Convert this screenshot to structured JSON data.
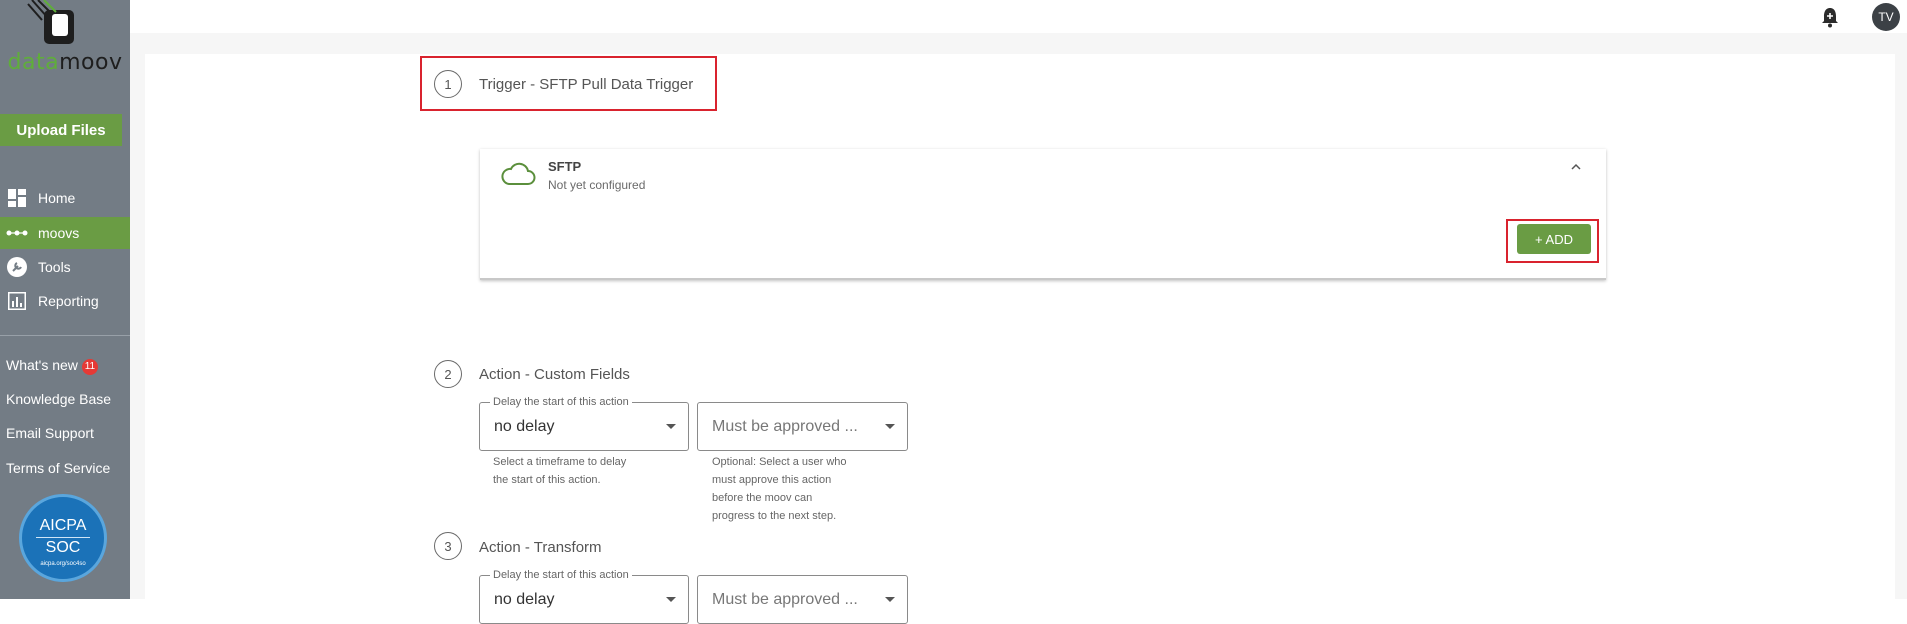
{
  "sidebar": {
    "logo": {
      "word_a": "data",
      "word_b": "moov"
    },
    "upload_label": "Upload Files",
    "nav": [
      {
        "label": "Home",
        "icon": "dashboard-icon"
      },
      {
        "label": "moovs",
        "icon": "dots-flow-icon"
      },
      {
        "label": "Tools",
        "icon": "wrench-icon"
      },
      {
        "label": "Reporting",
        "icon": "bar-chart-icon"
      }
    ],
    "links": {
      "whats_new": "What's new",
      "whats_new_badge": "11",
      "knowledge_base": "Knowledge Base",
      "email_support": "Email Support",
      "terms": "Terms of Service"
    },
    "badge_seal": {
      "top": "AICPA",
      "bottom": "SOC",
      "small": "aicpa.org/soc4so"
    }
  },
  "topbar": {
    "avatar_initials": "TV"
  },
  "colors": {
    "accent": "#6a9c44",
    "sidebar": "#737c85",
    "highlight": "#d9232e"
  },
  "steps": [
    {
      "number": "1",
      "title": "Trigger - SFTP Pull Data Trigger",
      "card": {
        "title": "SFTP",
        "subtitle": "Not yet configured",
        "add_label": "+ ADD"
      }
    },
    {
      "number": "2",
      "title": "Action - Custom Fields",
      "delay": {
        "label": "Delay the start of this action",
        "value": "no delay",
        "helper_1": "Select a timeframe to delay",
        "helper_2": "the start of this action."
      },
      "approval": {
        "value": "Must be approved ...",
        "helper_1": "Optional: Select a user who",
        "helper_2": "must approve this action",
        "helper_3": "before the moov can",
        "helper_4": "progress to the next step."
      }
    },
    {
      "number": "3",
      "title": "Action - Transform",
      "delay": {
        "label": "Delay the start of this action",
        "value": "no delay"
      },
      "approval": {
        "value": "Must be approved ..."
      }
    }
  ]
}
